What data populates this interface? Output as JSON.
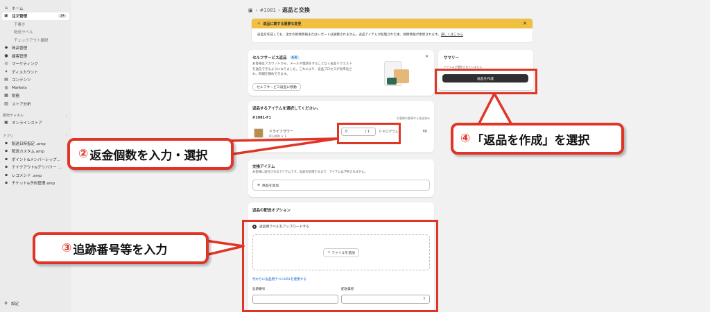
{
  "sidebar": {
    "items": [
      {
        "label": "ホーム",
        "icon": "home-icon"
      },
      {
        "label": "注文管理",
        "icon": "orders-icon",
        "badge": "14"
      },
      {
        "label": "下書き"
      },
      {
        "label": "配送ラベル"
      },
      {
        "label": "チェックアウト離脱"
      },
      {
        "label": "商品管理",
        "icon": "tag-icon"
      },
      {
        "label": "顧客管理",
        "icon": "person-icon"
      },
      {
        "label": "マーケティング",
        "icon": "target-icon"
      },
      {
        "label": "ディスカウント",
        "icon": "discount-icon"
      },
      {
        "label": "コンテンツ",
        "icon": "content-icon"
      },
      {
        "label": "Markets",
        "icon": "globe-icon"
      },
      {
        "label": "財務",
        "icon": "bank-icon"
      },
      {
        "label": "ストア分析",
        "icon": "chart-icon"
      }
    ],
    "sales_channels": {
      "title": "販売チャネル",
      "items": [
        {
          "label": "オンラインストア"
        }
      ]
    },
    "apps": {
      "title": "アプリ",
      "items": [
        {
          "label": "配送日時指定 .amp"
        },
        {
          "label": "配送カスタム.amp"
        },
        {
          "label": "ポイント&メンバーシップ…"
        },
        {
          "label": "テイクアウト&デリバリー …"
        },
        {
          "label": "レコメンド .amp"
        },
        {
          "label": "チケット&予約管理.amp"
        }
      ]
    },
    "settings": "設定"
  },
  "header": {
    "crumb": "#1081",
    "separator": "›",
    "title": "返品と交換"
  },
  "warning": {
    "title": "返品に関する重要な変更",
    "body": "返品を作成しても、注文の財務情報またはレポートは調整されません。返品アイテムが処理された後、財務情報が更新されます。",
    "link": "詳しくはこちら"
  },
  "self_service": {
    "title": "セルフサービス返品",
    "badge": "新規",
    "desc_1": "お客様はアカウントから、メールや電話をすることなく返品リクエスト",
    "desc_2": "を送信できるようになりました。これにより、返品プロセスが効率化さ",
    "desc_3": "れ、時間を節約できます。",
    "button": "セルフサービス返品に移動"
  },
  "summary": {
    "title": "サマリー",
    "note": "アイテムが選択されていません",
    "create_button": "返品を作成"
  },
  "items_card": {
    "title": "返品するアイテムを選択してください。",
    "order_id": "#1081-F1",
    "status": "お客様の倉庫から発送済み",
    "product_name": "ドライフラワー",
    "product_price": "¥1,000 × 1",
    "qty_value": "0",
    "qty_max": "/ 1",
    "weight": "0 キログラム",
    "line_total": "¥0"
  },
  "exchange": {
    "title": "交換アイテム",
    "desc": "お客様に送付されるアイテムです。返品を処理するまで、アイテムは予約されません。",
    "add_button": "商品を追加"
  },
  "delivery": {
    "title": "返品の配送オプション",
    "radio_label": "返品用ラベルをアップロードする",
    "file_button": "ファイルを追加",
    "alt_link": "代わりに返品用ラベルURLを使用する",
    "tracking_label": "追跡番号",
    "carrier_label": "配送業者"
  },
  "annotations": {
    "step2_num": "②",
    "step2": "返金個数を入力・選択",
    "step3_num": "③",
    "step3": "追跡番号等を入力",
    "step4_num": "④",
    "step4": "「返品を作成」を選択",
    "accent_color": "#e03526"
  }
}
